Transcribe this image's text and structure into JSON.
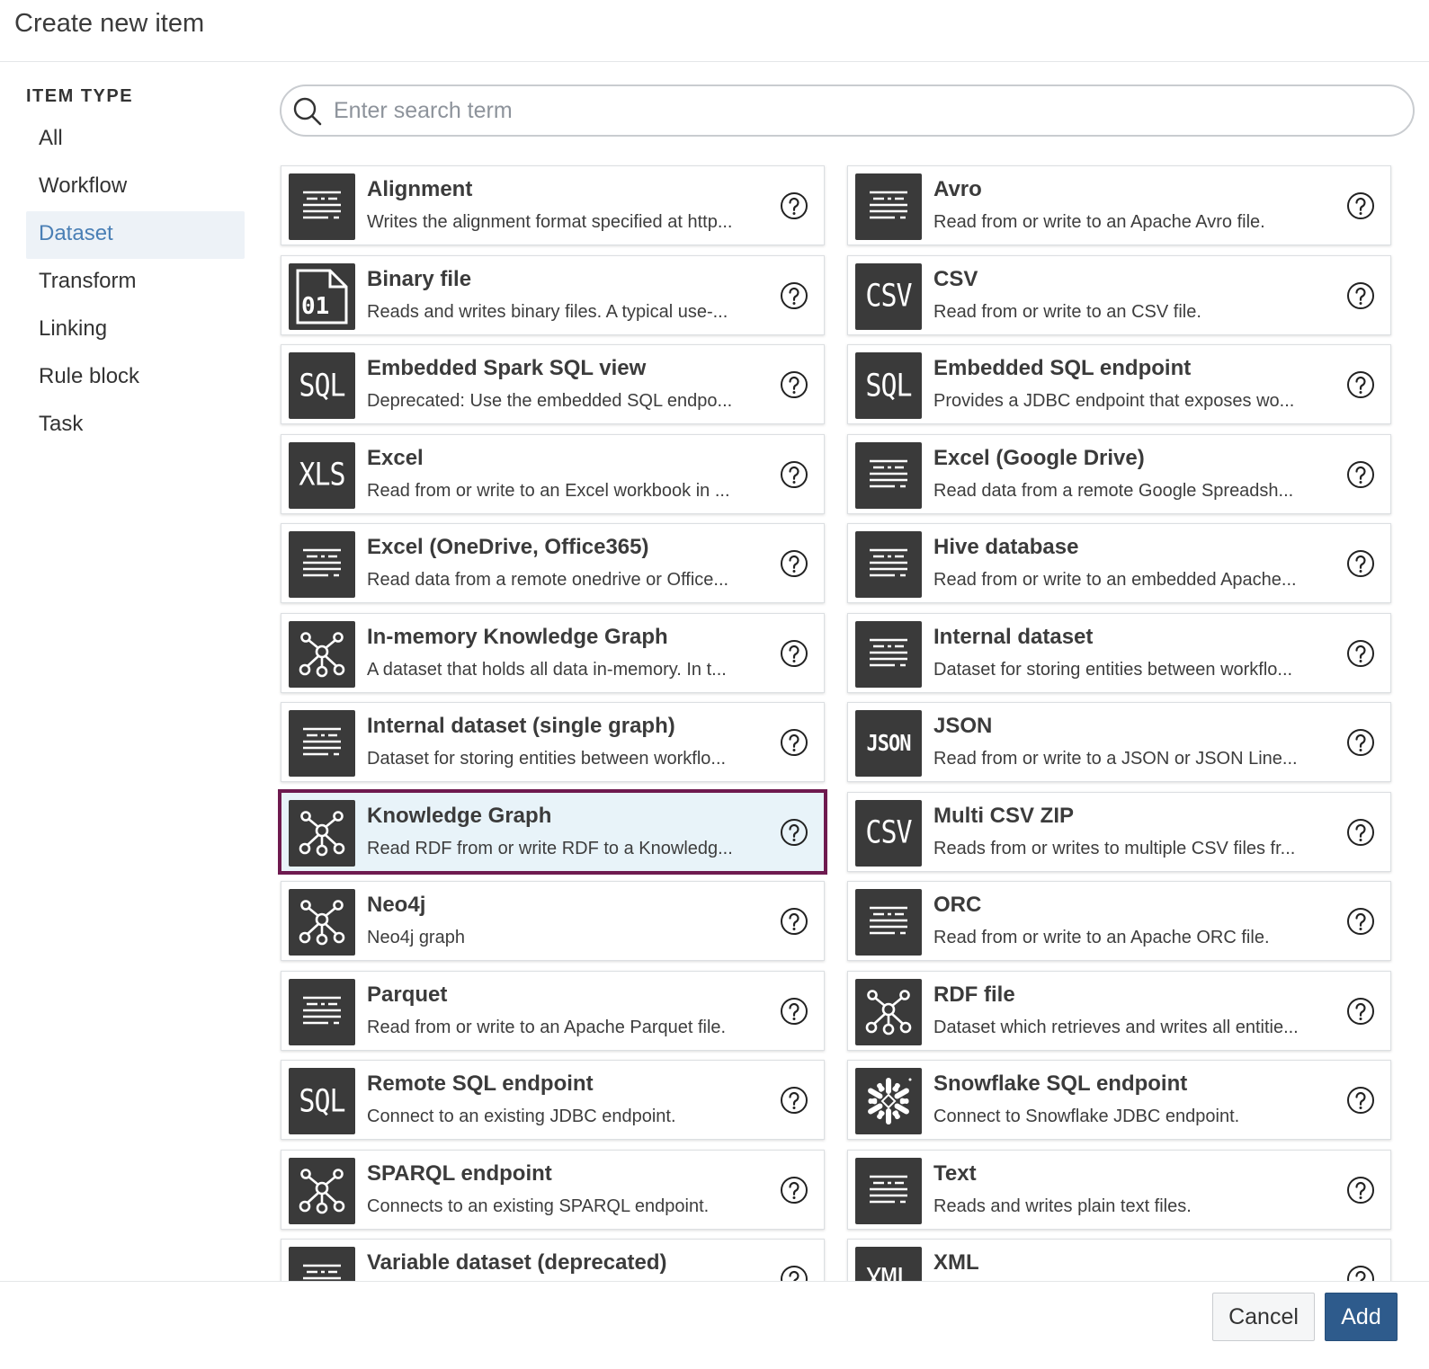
{
  "header": {
    "title": "Create new item"
  },
  "sidebar": {
    "section_title": "ITEM TYPE",
    "items": [
      {
        "label": "All",
        "active": false
      },
      {
        "label": "Workflow",
        "active": false
      },
      {
        "label": "Dataset",
        "active": true
      },
      {
        "label": "Transform",
        "active": false
      },
      {
        "label": "Linking",
        "active": false
      },
      {
        "label": "Rule block",
        "active": false
      },
      {
        "label": "Task",
        "active": false
      }
    ]
  },
  "search": {
    "placeholder": "Enter search term",
    "value": ""
  },
  "items": [
    {
      "name": "Alignment",
      "description": "Writes the alignment format specified at http...",
      "icon": "lines-icon",
      "icon_text": ""
    },
    {
      "name": "Avro",
      "description": "Read from or write to an Apache Avro file.",
      "icon": "lines-icon",
      "icon_text": ""
    },
    {
      "name": "Binary file",
      "description": "Reads and writes binary files. A typical use-...",
      "icon": "binary-file-icon",
      "icon_text": ""
    },
    {
      "name": "CSV",
      "description": "Read from or write to an CSV file.",
      "icon": "text-icon",
      "icon_text": "CSV"
    },
    {
      "name": "Embedded Spark SQL view",
      "description": "Deprecated: Use the embedded SQL endpo...",
      "icon": "text-icon",
      "icon_text": "SQL"
    },
    {
      "name": "Embedded SQL endpoint",
      "description": "Provides a JDBC endpoint that exposes wo...",
      "icon": "text-icon",
      "icon_text": "SQL"
    },
    {
      "name": "Excel",
      "description": "Read from or write to an Excel workbook in ...",
      "icon": "text-icon",
      "icon_text": "XLS"
    },
    {
      "name": "Excel (Google Drive)",
      "description": "Read data from a remote Google Spreadsh...",
      "icon": "lines-icon",
      "icon_text": ""
    },
    {
      "name": "Excel (OneDrive, Office365)",
      "description": "Read data from a remote onedrive or Office...",
      "icon": "lines-icon",
      "icon_text": ""
    },
    {
      "name": "Hive database",
      "description": "Read from or write to an embedded Apache...",
      "icon": "lines-icon",
      "icon_text": ""
    },
    {
      "name": "In-memory Knowledge Graph",
      "description": "A dataset that holds all data in-memory. In t...",
      "icon": "graph-icon",
      "icon_text": ""
    },
    {
      "name": "Internal dataset",
      "description": "Dataset for storing entities between workflo...",
      "icon": "lines-icon",
      "icon_text": ""
    },
    {
      "name": "Internal dataset (single graph)",
      "description": "Dataset for storing entities between workflo...",
      "icon": "lines-icon",
      "icon_text": ""
    },
    {
      "name": "JSON",
      "description": "Read from or write to a JSON or JSON Line...",
      "icon": "text-icon",
      "icon_text": "JSON"
    },
    {
      "name": "Knowledge Graph",
      "description": "Read RDF from or write RDF to a Knowledg...",
      "icon": "graph-icon",
      "icon_text": "",
      "selected": true
    },
    {
      "name": "Multi CSV ZIP",
      "description": "Reads from or writes to multiple CSV files fr...",
      "icon": "text-icon",
      "icon_text": "CSV"
    },
    {
      "name": "Neo4j",
      "description": "Neo4j graph",
      "icon": "graph-icon",
      "icon_text": ""
    },
    {
      "name": "ORC",
      "description": "Read from or write to an Apache ORC file.",
      "icon": "lines-icon",
      "icon_text": ""
    },
    {
      "name": "Parquet",
      "description": "Read from or write to an Apache Parquet file.",
      "icon": "lines-icon",
      "icon_text": ""
    },
    {
      "name": "RDF file",
      "description": "Dataset which retrieves and writes all entitie...",
      "icon": "graph-icon",
      "icon_text": ""
    },
    {
      "name": "Remote SQL endpoint",
      "description": "Connect to an existing JDBC endpoint.",
      "icon": "text-icon",
      "icon_text": "SQL"
    },
    {
      "name": "Snowflake SQL endpoint",
      "description": "Connect to Snowflake JDBC endpoint.",
      "icon": "snowflake-icon",
      "icon_text": ""
    },
    {
      "name": "SPARQL endpoint",
      "description": "Connects to an existing SPARQL endpoint.",
      "icon": "graph-icon",
      "icon_text": ""
    },
    {
      "name": "Text",
      "description": "Reads and writes plain text files.",
      "icon": "lines-icon",
      "icon_text": ""
    },
    {
      "name": "Variable dataset (deprecated)",
      "description": "",
      "icon": "lines-icon",
      "icon_text": ""
    },
    {
      "name": "XML",
      "description": "",
      "icon": "text-icon",
      "icon_text": "XML"
    }
  ],
  "footer": {
    "cancel_label": "Cancel",
    "add_label": "Add"
  },
  "colors": {
    "accent": "#2e5b8c",
    "selected_border": "#6e1a4f",
    "selected_bg": "#e8f3f9",
    "active_nav_text": "#4a7fb5",
    "icon_bg": "#3a3a3a"
  }
}
